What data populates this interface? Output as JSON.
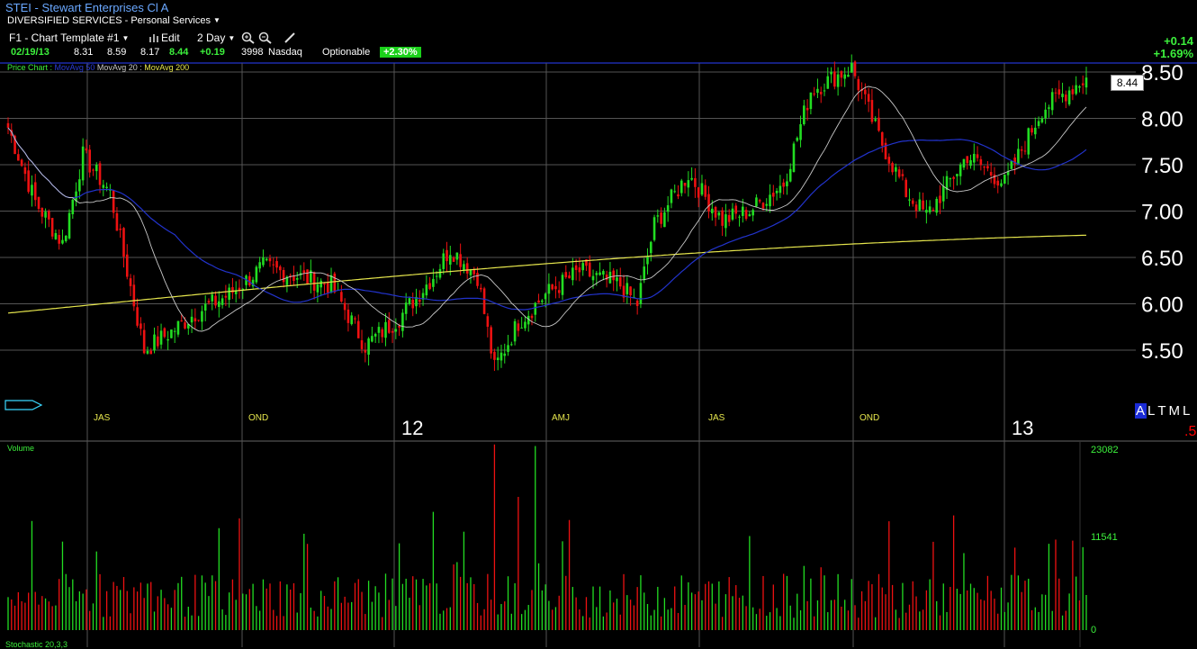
{
  "header": {
    "title": "STEI - Stewart Enterprises Cl A",
    "sector": "DIVERSIFIED SERVICES - Personal Services",
    "change_abs": "+0.14",
    "change_pct": "+1.69%"
  },
  "toolbar": {
    "template": "F1 - Chart Template #1",
    "edit_label": "Edit",
    "period": "2 Day",
    "zoom_in_icon": "zoom-in-icon",
    "zoom_out_icon": "zoom-out-icon",
    "draw_icon": "pencil-icon"
  },
  "quote": {
    "date": "02/19/13",
    "open": "8.31",
    "high": "8.59",
    "low": "8.17",
    "last": "8.44",
    "change": "+0.19",
    "volume": "3998",
    "exchange": "Nasdaq",
    "optionable": "Optionable",
    "pct_badge": "+2.30%"
  },
  "legend": {
    "price_chart": "Price Chart :",
    "ma50": "MovAvg 50",
    "ma20": "MovAvg 20 :",
    "ma200": "MovAvg 200"
  },
  "last_price_tag": "8.44",
  "range_tabs": [
    "A",
    "L",
    "T",
    "M",
    "L"
  ],
  "range_selected": "A",
  "red_mark": ".5",
  "volume_panel": {
    "label": "Volume",
    "ticks": [
      "23082",
      "11541",
      "0"
    ]
  },
  "bottom_indicator": "Stochastic 20,3,3",
  "colors": {
    "background": "#000000",
    "up": "#22dd22",
    "down": "#ee1111",
    "ma50": "#2233cc",
    "ma20": "#c8c8c8",
    "ma200": "#e6e64d",
    "grid": "#555555",
    "axis_text": "#ffffff",
    "time_label": "#e6e64d"
  },
  "chart_data": {
    "type": "candlestick",
    "y_axis_labels": [
      "8.50",
      "8.00",
      "7.50",
      "7.00",
      "6.50",
      "6.00",
      "5.50"
    ],
    "ylim": [
      5.0,
      8.6
    ],
    "time_labels": [
      "JAS",
      "OND",
      "12",
      "AMJ",
      "JAS",
      "OND",
      "13"
    ],
    "last_price": 8.44,
    "ma200_range": [
      5.9,
      6.74
    ],
    "volume_max": 23082
  }
}
